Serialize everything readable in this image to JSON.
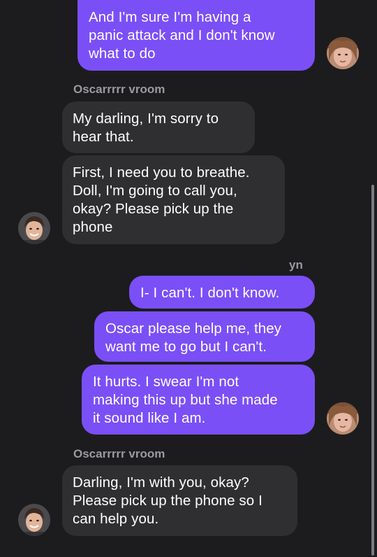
{
  "thread": {
    "sender_a_label": "Oscarrrrr vroom",
    "sender_a_label_2": "Oscarrrrr vroom",
    "sender_b_label": "yn"
  },
  "messages": [
    {
      "from": "yn",
      "text": "And I'm sure I'm having a\npanic attack and I don't know\nwhat to do"
    },
    {
      "from": "Oscarrrrr vroom",
      "text": "My darling, I'm sorry to\nhear that."
    },
    {
      "from": "Oscarrrrr vroom",
      "text": "First, I need you to breathe.\nDoll, I'm going to call you,\nokay? Please pick up the\nphone"
    },
    {
      "from": "yn",
      "text": "I- I can't. I don't know."
    },
    {
      "from": "yn",
      "text": "Oscar please help me, they\nwant me to go but I can't."
    },
    {
      "from": "yn",
      "text": "It hurts. I swear I'm not\nmaking this up but she made\nit sound like I am."
    },
    {
      "from": "Oscarrrrr vroom",
      "text": "Darling, I'm with you, okay?\nPlease pick up the phone so I\ncan help you."
    }
  ],
  "colors": {
    "background": "#1c1c1e",
    "outgoing_bubble": "#7b4ff6",
    "incoming_bubble": "#2f2f31",
    "sender_label": "#9a9a9f"
  },
  "avatars": {
    "yn": "photo-avatar-yn",
    "oscar": "photo-avatar-oscar"
  }
}
